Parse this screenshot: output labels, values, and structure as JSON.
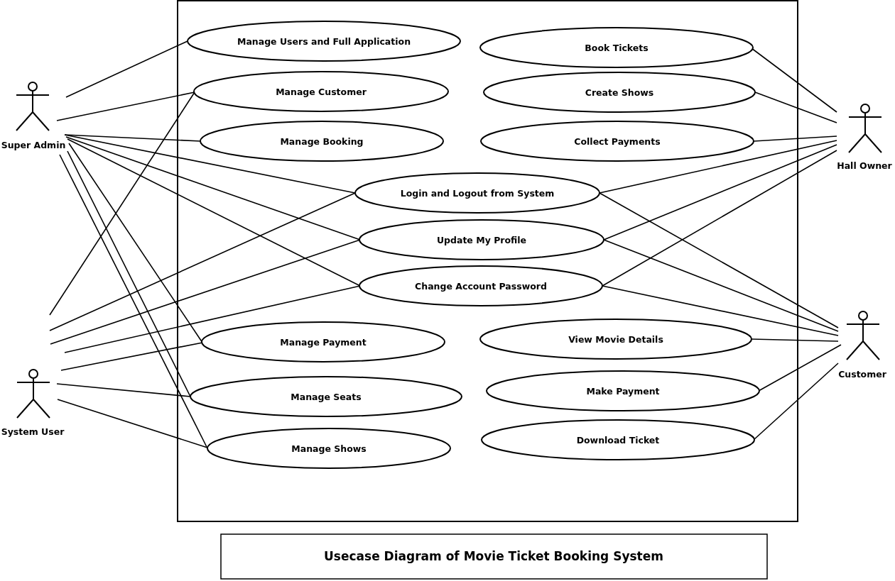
{
  "actors": [
    {
      "name": "Super Admin"
    },
    {
      "name": "System User"
    },
    {
      "name": "Hall Owner"
    },
    {
      "name": "Customer"
    }
  ],
  "use_cases": [
    {
      "label": "Manage Users and Full Application"
    },
    {
      "label": "Manage Customer"
    },
    {
      "label": "Manage Booking"
    },
    {
      "label": "Login and Logout from System"
    },
    {
      "label": "Update My Profile"
    },
    {
      "label": "Change Account Password"
    },
    {
      "label": "Manage Payment"
    },
    {
      "label": "Manage Seats"
    },
    {
      "label": "Manage Shows"
    },
    {
      "label": "Book Tickets"
    },
    {
      "label": "Create Shows"
    },
    {
      "label": "Collect Payments"
    },
    {
      "label": "View Movie Details"
    },
    {
      "label": "Make Payment"
    },
    {
      "label": "Download Ticket"
    }
  ],
  "caption": "Usecase Diagram of Movie Ticket Booking System"
}
